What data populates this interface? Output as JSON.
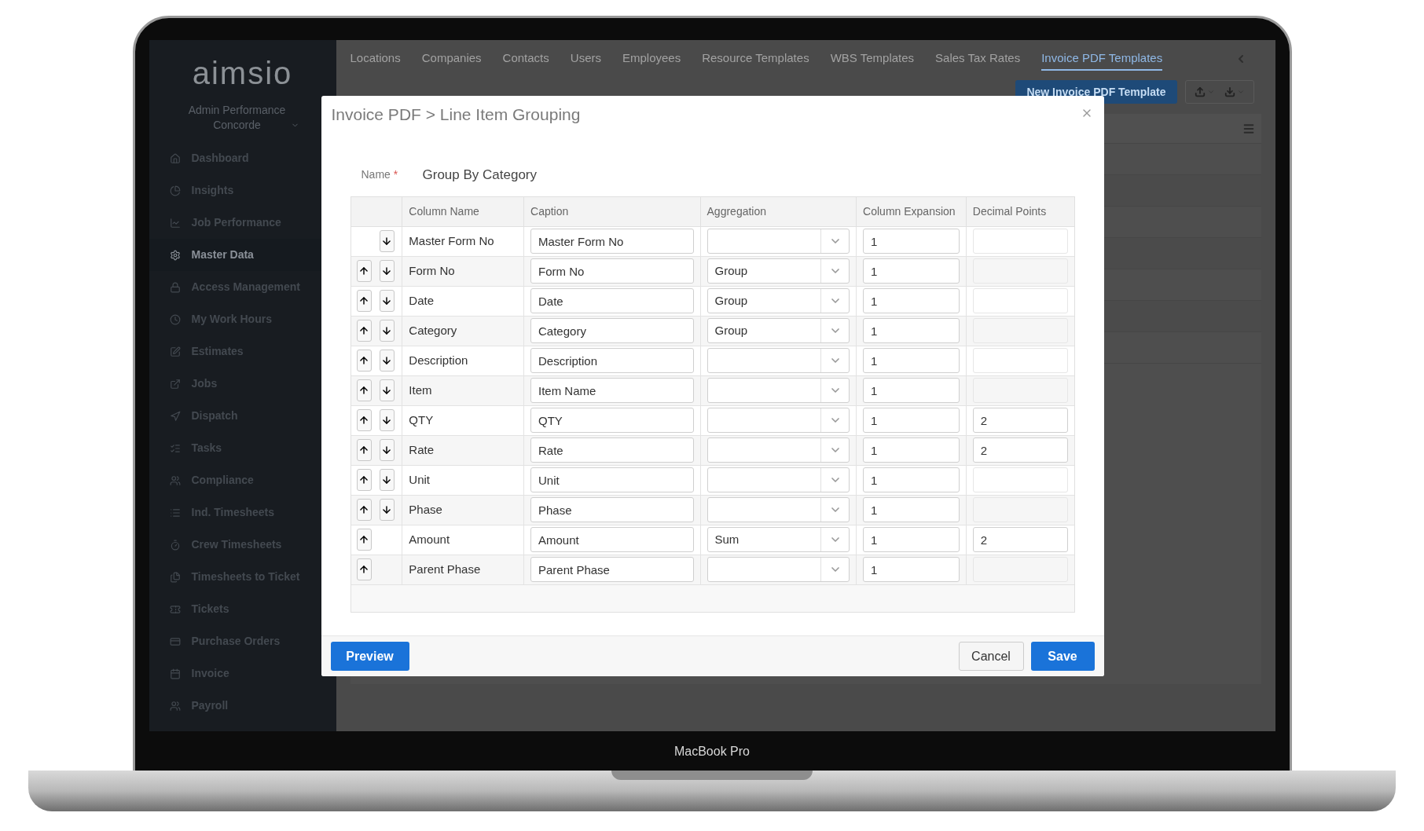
{
  "device": {
    "label": "MacBook Pro"
  },
  "sidebar": {
    "logo": "aimsio",
    "account": "Admin Performance Concorde",
    "items": [
      {
        "label": "Dashboard",
        "selected": false
      },
      {
        "label": "Insights",
        "selected": false
      },
      {
        "label": "Job Performance",
        "selected": false
      },
      {
        "label": "Master Data",
        "selected": true
      },
      {
        "label": "Access Management",
        "selected": false
      },
      {
        "label": "My Work Hours",
        "selected": false
      },
      {
        "label": "Estimates",
        "selected": false
      },
      {
        "label": "Jobs",
        "selected": false
      },
      {
        "label": "Dispatch",
        "selected": false
      },
      {
        "label": "Tasks",
        "selected": false
      },
      {
        "label": "Compliance",
        "selected": false
      },
      {
        "label": "Ind. Timesheets",
        "selected": false
      },
      {
        "label": "Crew Timesheets",
        "selected": false
      },
      {
        "label": "Timesheets to Ticket",
        "selected": false
      },
      {
        "label": "Tickets",
        "selected": false
      },
      {
        "label": "Purchase Orders",
        "selected": false
      },
      {
        "label": "Invoice",
        "selected": false
      },
      {
        "label": "Payroll",
        "selected": false
      }
    ]
  },
  "top_tabs": [
    {
      "label": "Locations",
      "selected": false
    },
    {
      "label": "Companies",
      "selected": false
    },
    {
      "label": "Contacts",
      "selected": false
    },
    {
      "label": "Users",
      "selected": false
    },
    {
      "label": "Employees",
      "selected": false
    },
    {
      "label": "Resource Templates",
      "selected": false
    },
    {
      "label": "WBS Templates",
      "selected": false
    },
    {
      "label": "Sales Tax Rates",
      "selected": false
    },
    {
      "label": "Invoice PDF Templates",
      "selected": true
    }
  ],
  "toolbar": {
    "new_button": "New Invoice PDF Template"
  },
  "dialog": {
    "title": "Invoice PDF > Line Item Grouping",
    "name_label": "Name",
    "required_mark": "*",
    "name_value": "Group By Category",
    "columns": [
      "Column Name",
      "Caption",
      "Aggregation",
      "Column Expansion",
      "Decimal Points"
    ],
    "rows": [
      {
        "up": false,
        "down": true,
        "column_name": "Master Form No",
        "caption": "Master Form No",
        "expansion": "1"
      },
      {
        "up": true,
        "down": true,
        "column_name": "Form No",
        "caption": "Form No",
        "aggregation": "Group",
        "expansion": "1"
      },
      {
        "up": true,
        "down": true,
        "column_name": "Date",
        "caption": "Date",
        "aggregation": "Group",
        "expansion": "1"
      },
      {
        "up": true,
        "down": true,
        "column_name": "Category",
        "caption": "Category",
        "aggregation": "Group",
        "expansion": "1"
      },
      {
        "up": true,
        "down": true,
        "column_name": "Description",
        "caption": "Description",
        "expansion": "1"
      },
      {
        "up": true,
        "down": true,
        "column_name": "Item",
        "caption": "Item Name",
        "expansion": "1"
      },
      {
        "up": true,
        "down": true,
        "column_name": "QTY",
        "caption": "QTY",
        "expansion": "1",
        "decimal": "2"
      },
      {
        "up": true,
        "down": true,
        "column_name": "Rate",
        "caption": "Rate",
        "expansion": "1",
        "decimal": "2"
      },
      {
        "up": true,
        "down": true,
        "column_name": "Unit",
        "caption": "Unit",
        "expansion": "1"
      },
      {
        "up": true,
        "down": true,
        "column_name": "Phase",
        "caption": "Phase",
        "expansion": "1"
      },
      {
        "up": true,
        "down": false,
        "column_name": "Amount",
        "caption": "Amount",
        "aggregation": "Sum",
        "expansion": "1",
        "decimal": "2"
      },
      {
        "up": true,
        "down": false,
        "column_name": "Parent Phase",
        "caption": "Parent Phase",
        "expansion": "1"
      }
    ],
    "buttons": {
      "preview": "Preview",
      "cancel": "Cancel",
      "save": "Save"
    }
  }
}
